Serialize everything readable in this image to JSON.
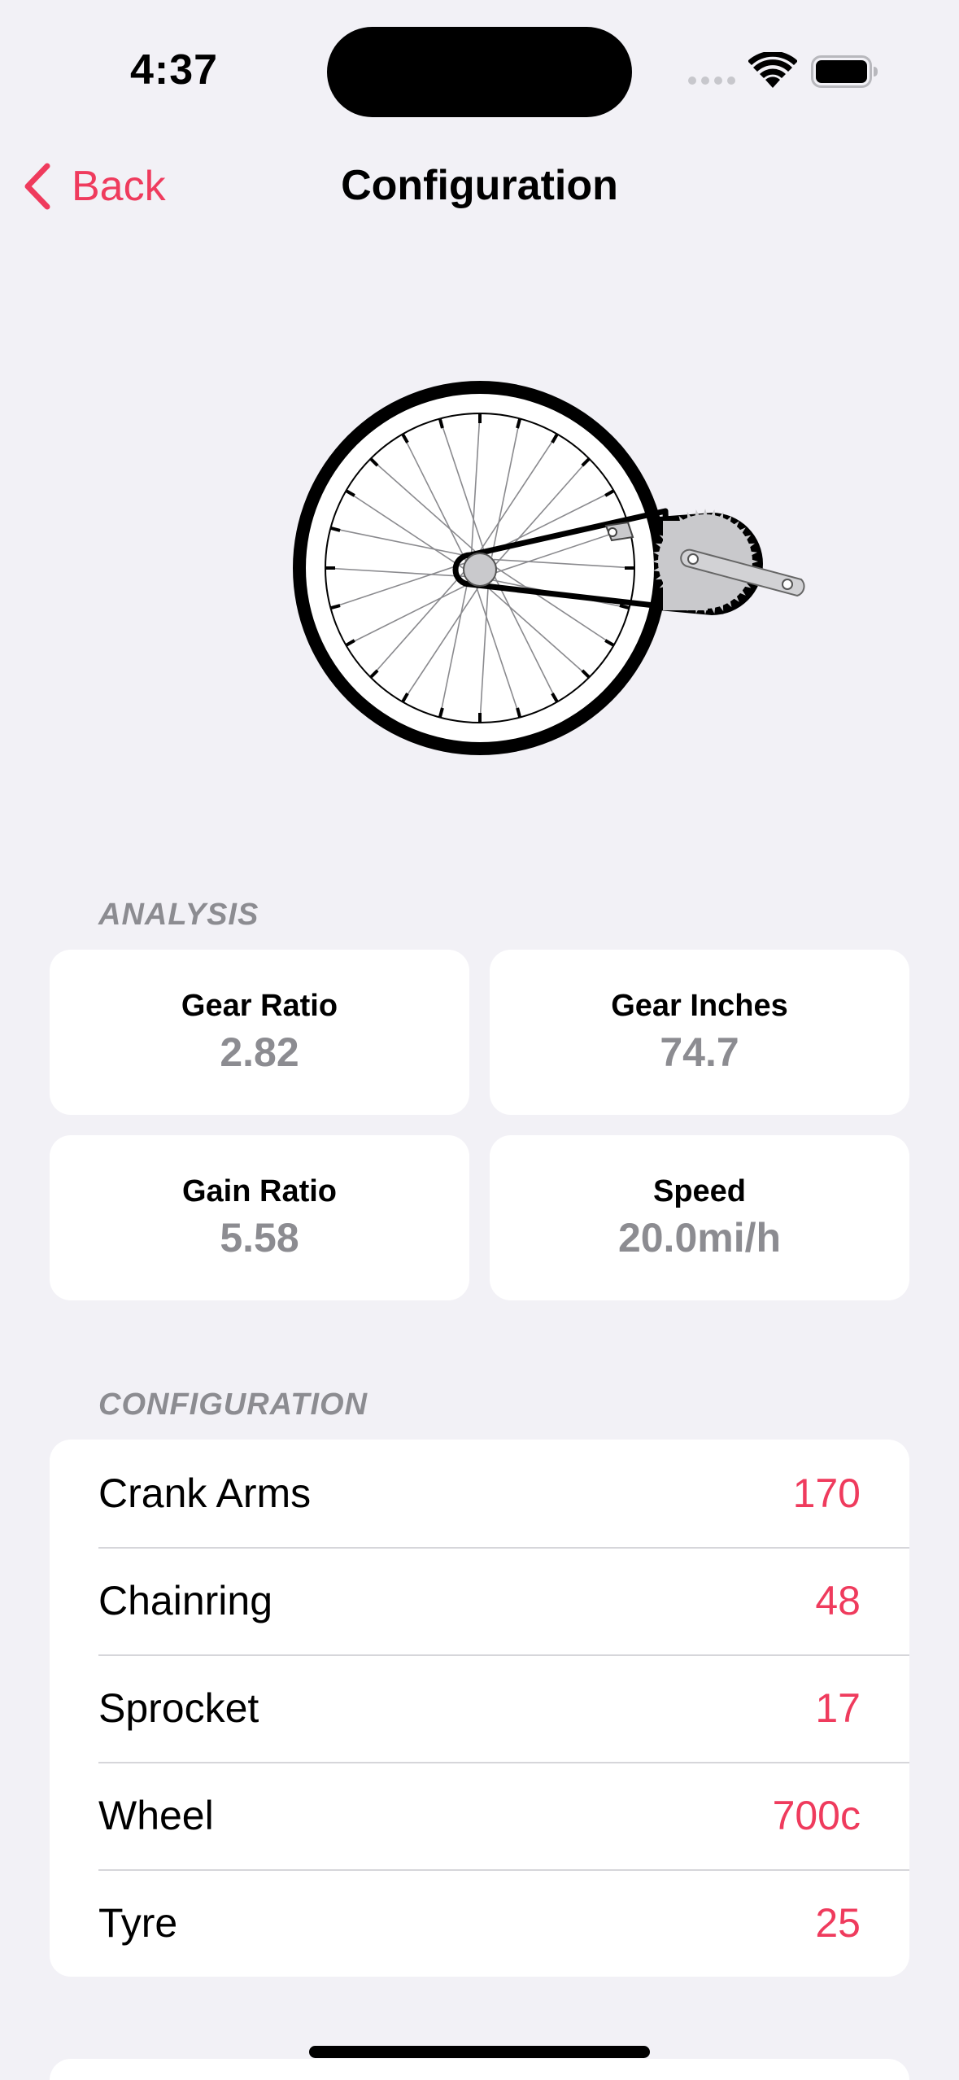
{
  "status_bar": {
    "time": "4:37"
  },
  "nav": {
    "back_label": "Back",
    "title": "Configuration"
  },
  "analysis": {
    "header": "ANALYSIS",
    "cards": [
      {
        "label": "Gear Ratio",
        "value": "2.82"
      },
      {
        "label": "Gear Inches",
        "value": "74.7"
      },
      {
        "label": "Gain Ratio",
        "value": "5.58"
      },
      {
        "label": "Speed",
        "value": "20.0mi/h"
      }
    ]
  },
  "configuration": {
    "header": "CONFIGURATION",
    "rows": [
      {
        "label": "Crank Arms",
        "value": "170"
      },
      {
        "label": "Chainring",
        "value": "48"
      },
      {
        "label": "Sprocket",
        "value": "17"
      },
      {
        "label": "Wheel",
        "value": "700c"
      },
      {
        "label": "Tyre",
        "value": "25"
      }
    ]
  },
  "colors": {
    "accent": "#ef3b5d",
    "background": "#f2f1f6",
    "secondary_text": "#8c8c91"
  },
  "icons": [
    "chevron-left-icon",
    "wifi-icon",
    "battery-icon",
    "signal-icon"
  ]
}
